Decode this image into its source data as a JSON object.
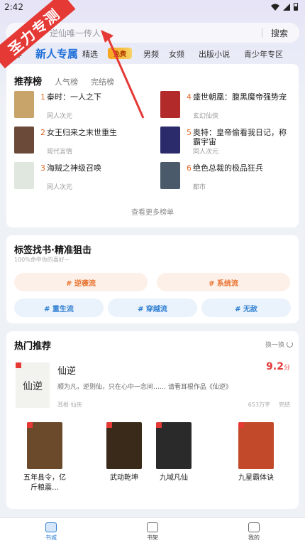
{
  "status": {
    "time": "2:42"
  },
  "stamp": "圣力专测",
  "search": {
    "placeholder": "逆仙唯一传人",
    "button": "搜索"
  },
  "tabs": {
    "partial_left": "荐",
    "active": "新人专属",
    "items": [
      "精选",
      "男频",
      "女频",
      "出版小说",
      "青少年专区"
    ],
    "badge": "免费"
  },
  "ranking": {
    "tabs": [
      "推荐榜",
      "人气榜",
      "完结榜"
    ],
    "items": [
      {
        "num": "1",
        "title": "秦时：一人之下",
        "category": "同人次元",
        "color": "#c8a46b"
      },
      {
        "num": "2",
        "title": "女王归来之末世重生",
        "category": "现代言情",
        "color": "#6b4a3a"
      },
      {
        "num": "3",
        "title": "海贼之神级召唤",
        "category": "同人次元",
        "color": "#dfe7df"
      },
      {
        "num": "4",
        "title": "盛世朝凰：腹黑魔帝强势宠",
        "category": "玄幻仙侠",
        "color": "#b22a2a"
      },
      {
        "num": "5",
        "title": "奥特：皇帝偷看我日记，称霸宇宙",
        "category": "同人次元",
        "color": "#2b2a6a"
      },
      {
        "num": "6",
        "title": "绝色总裁的极品狂兵",
        "category": "都市",
        "color": "#4b5a6a"
      }
    ],
    "more": "查看更多榜单"
  },
  "tags": {
    "title": "标签找书·精准狙击",
    "subtitle": "100%命中你的喜好~",
    "warm": [
      "# 逆袭流",
      "# 系统流"
    ],
    "cool": [
      "# 重生流",
      "# 穿越流",
      "# 无敌"
    ]
  },
  "hot": {
    "title": "热门推荐",
    "refresh": "换一换",
    "feature": {
      "name": "仙逆",
      "score": "9.2",
      "score_unit": "分",
      "desc": "顺为凡，逆则仙，只在心中一念间……  请看耳根作品《仙逆》",
      "meta": "耳根·仙侠",
      "words": "653万字",
      "status": "完结",
      "cover_text": "仙逆"
    },
    "books": [
      {
        "name": "五年县令，亿斤粮震…",
        "color": "#6a4a2a"
      },
      {
        "name": "武动乾坤",
        "color": "#3a2a1a"
      },
      {
        "name": "九域凡仙",
        "color": "#2a2a2a"
      },
      {
        "name": "九星霸体诀",
        "color": "#c24a2a"
      }
    ]
  },
  "bottom_nav": [
    "书城",
    "书架",
    "我的"
  ]
}
